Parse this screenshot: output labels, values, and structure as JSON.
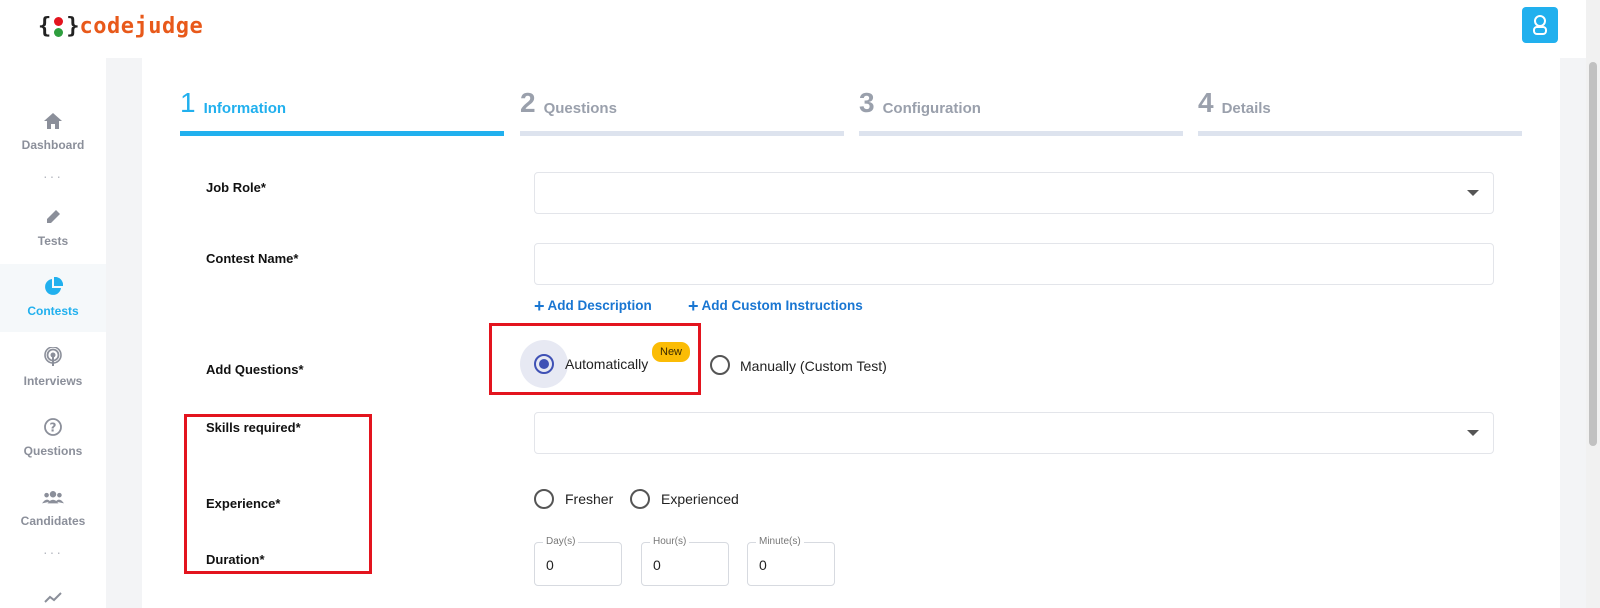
{
  "brand": {
    "open_brace": "{",
    "close_brace": "}",
    "name": "codejudge",
    "dot_top_color": "#e3141e",
    "dot_bottom_color": "#2e9e3e"
  },
  "header": {
    "user_icon": "user-icon",
    "accent": "#21b0ee"
  },
  "sidebar": {
    "items": [
      {
        "label": "Dashboard",
        "icon": "home-icon"
      },
      {
        "label": "Tests",
        "icon": "pen-icon"
      },
      {
        "label": "Contests",
        "icon": "pie-chart-icon",
        "active": true
      },
      {
        "label": "Interviews",
        "icon": "broadcast-icon"
      },
      {
        "label": "Questions",
        "icon": "question-circle-icon"
      },
      {
        "label": "Candidates",
        "icon": "users-icon"
      }
    ],
    "more": "···"
  },
  "steps": [
    {
      "num": "1",
      "label": "Information",
      "active": true
    },
    {
      "num": "2",
      "label": "Questions"
    },
    {
      "num": "3",
      "label": "Configuration"
    },
    {
      "num": "4",
      "label": "Details"
    }
  ],
  "form": {
    "job_role": {
      "label": "Job Role*",
      "value": ""
    },
    "contest_name": {
      "label": "Contest Name*",
      "value": ""
    },
    "add_description": "Add Description",
    "add_custom_instructions": "Add Custom Instructions",
    "add_questions": {
      "label": "Add Questions*",
      "options": [
        "Automatically",
        "Manually (Custom Test)"
      ],
      "selected": "Automatically",
      "badge": "New"
    },
    "skills": {
      "label": "Skills required*",
      "value": ""
    },
    "experience": {
      "label": "Experience*",
      "options": [
        "Fresher",
        "Experienced"
      ]
    },
    "duration": {
      "label": "Duration*",
      "fields": [
        {
          "caption": "Day(s)",
          "value": "0"
        },
        {
          "caption": "Hour(s)",
          "value": "0"
        },
        {
          "caption": "Minute(s)",
          "value": "0"
        }
      ]
    }
  },
  "colors": {
    "accent": "#21b0ee",
    "link": "#1976d2",
    "radio_checked": "#3f51b5",
    "badge": "#fbbc05",
    "highlight": "#e3141e"
  }
}
